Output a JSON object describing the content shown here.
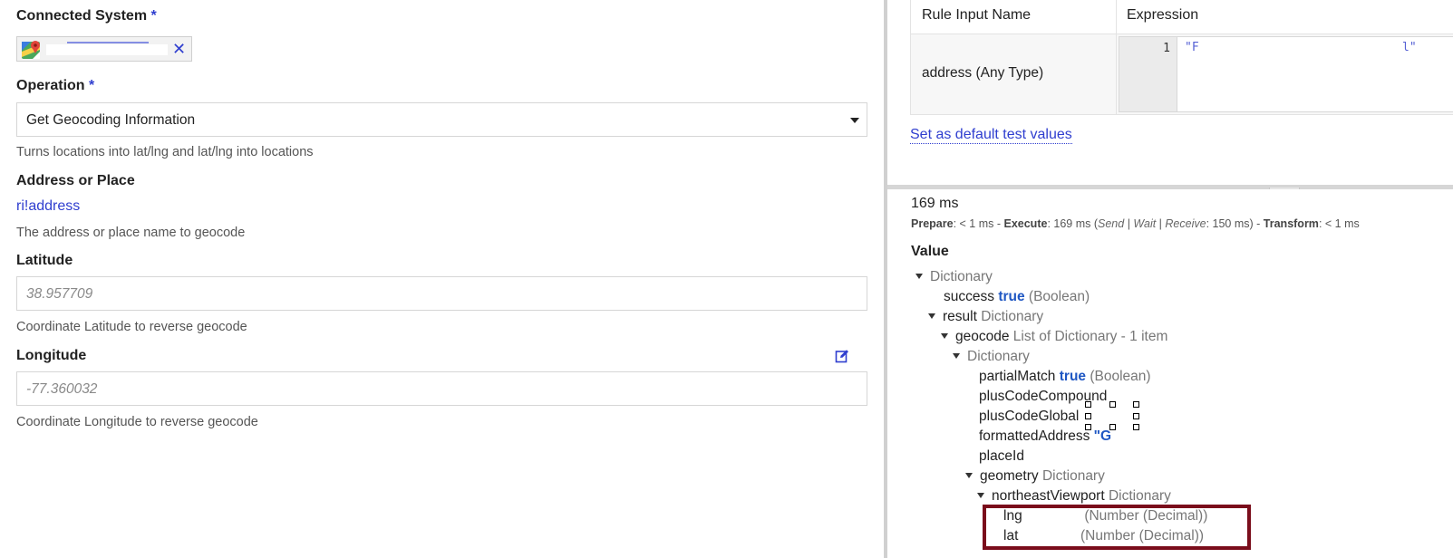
{
  "left_panel": {
    "connected_system": {
      "label": "Connected System",
      "required_mark": "*",
      "remove_icon": "close-icon",
      "map_icon": "google-maps-icon"
    },
    "operation": {
      "label": "Operation",
      "required_mark": "*",
      "value": "Get Geocoding Information",
      "help": "Turns locations into lat/lng and lat/lng into locations"
    },
    "address": {
      "label": "Address or Place",
      "value": "ri!address",
      "help": "The address or place name to geocode"
    },
    "latitude": {
      "label": "Latitude",
      "placeholder": "38.957709",
      "help": "Coordinate Latitude to reverse geocode"
    },
    "longitude": {
      "label": "Longitude",
      "placeholder": "-77.360032",
      "help": "Coordinate Longitude to reverse geocode",
      "edit_icon": "edit-icon"
    }
  },
  "test_inputs": {
    "col_name": "Rule Input Name",
    "col_expression": "Expression",
    "rows": [
      {
        "name": "address (Any Type)",
        "line_number": "1",
        "expression_start": "\"F",
        "expression_end": "l\""
      }
    ],
    "set_default_link": "Set as default test values"
  },
  "result": {
    "total_time": "169 ms",
    "timing": {
      "prepare_label": "Prepare",
      "prepare_value": ": < 1 ms - ",
      "execute_label": "Execute",
      "execute_value": ": 169 ms (",
      "send": "Send",
      "slash1": " | ",
      "wait": "Wait",
      "slash2": " | ",
      "receive": "Receive",
      "execute_tail": ": 150 ms) - ",
      "transform_label": "Transform",
      "transform_value": ": < 1 ms"
    },
    "value_label": "Value",
    "tree": {
      "root": "Dictionary",
      "success_key": "success",
      "success_val": "true",
      "success_type": "(Boolean)",
      "result_key": "result",
      "result_type": "Dictionary",
      "geocode_key": "geocode",
      "geocode_type": "List of Dictionary - 1 item",
      "inner_dict": "Dictionary",
      "partial_key": "partialMatch",
      "partial_val": "true",
      "partial_type": "(Boolean)",
      "plus_compound_key": "plusCodeCompound",
      "plus_global_key": "plusCodeGlobal",
      "formatted_key": "formattedAddress",
      "formatted_val": "\"G",
      "placeid_key": "placeId",
      "geometry_key": "geometry",
      "geometry_type": "Dictionary",
      "ne_key": "northeastViewport",
      "ne_type": "Dictionary",
      "lng_key": "lng",
      "lng_type": "(Number (Decimal))",
      "lat_key": "lat",
      "lat_type": "(Number (Decimal))"
    }
  },
  "colors": {
    "accent": "#2f3ecf",
    "keyword": "#1f57c3",
    "highlight_box": "#7a0d1b"
  }
}
